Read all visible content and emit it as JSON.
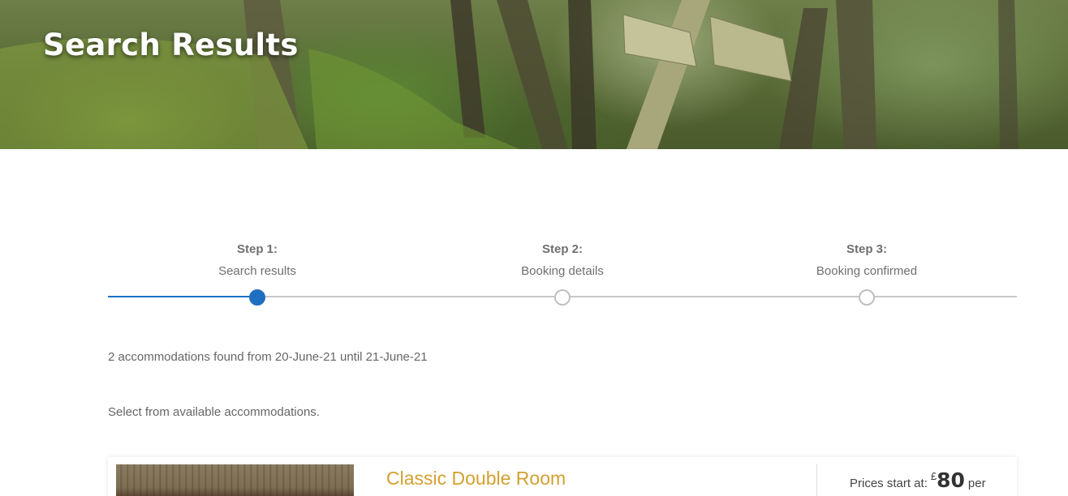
{
  "hero": {
    "title": "Search Results"
  },
  "stepper": {
    "steps": [
      {
        "number": "Step 1:",
        "name": "Search results",
        "status": "active"
      },
      {
        "number": "Step 2:",
        "name": "Booking details",
        "status": "pending"
      },
      {
        "number": "Step 3:",
        "name": "Booking confirmed",
        "status": "pending"
      }
    ]
  },
  "results": {
    "summary": "2 accommodations found from 20-June-21 until 21-June-21",
    "instruction": "Select from available accommodations.",
    "items": [
      {
        "title": "Classic Double Room",
        "price_prefix": "Prices start at:",
        "currency": "£",
        "price": "80",
        "price_unit": "per"
      }
    ]
  },
  "colors": {
    "accent": "#1e6fbf",
    "title_gold": "#d4a02f",
    "track": "#c8c8c8"
  }
}
